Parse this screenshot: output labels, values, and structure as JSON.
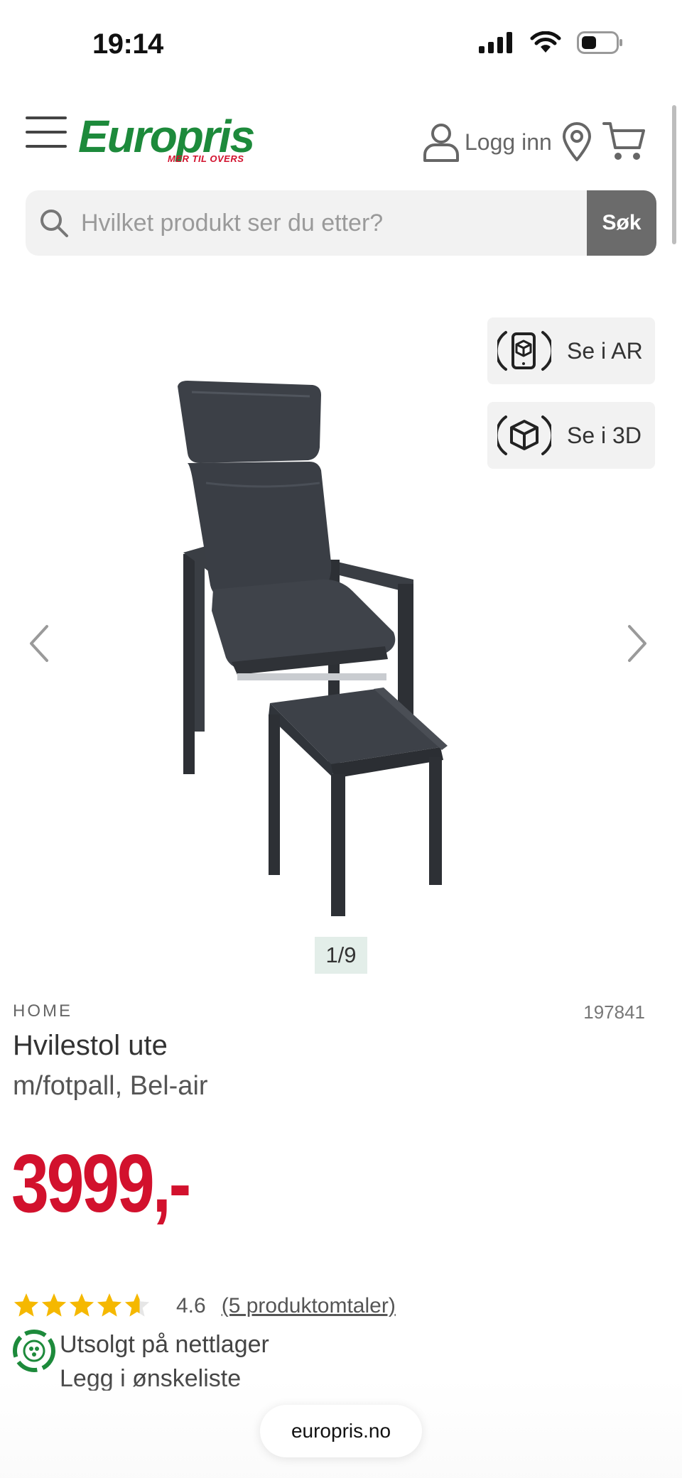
{
  "status_bar": {
    "time": "19:14"
  },
  "header": {
    "logo_text": "Europris",
    "logo_tagline": "MER TIL OVERS",
    "login_label": "Logg inn"
  },
  "search": {
    "placeholder": "Hvilket produkt ser du etter?",
    "button_label": "Søk"
  },
  "viewer": {
    "ar_label": "Se i AR",
    "3d_label": "Se i 3D",
    "image_counter": "1/9"
  },
  "product": {
    "brand": "HOME",
    "sku": "197841",
    "title": "Hvilestol ute",
    "subtitle": "m/fotpall, Bel-air",
    "price": "3999,-",
    "rating_value": "4.6",
    "rating_fraction": 0.92,
    "reviews_link": "(5 produktomtaler)",
    "sold_online": "Utsolgt på nettlager",
    "wishlist": "Legg i ønskeliste"
  },
  "browser": {
    "url": "europris.no"
  },
  "colors": {
    "brand_green": "#1d8a3b",
    "price_red": "#d2112d",
    "star_yellow": "#f5b800"
  }
}
